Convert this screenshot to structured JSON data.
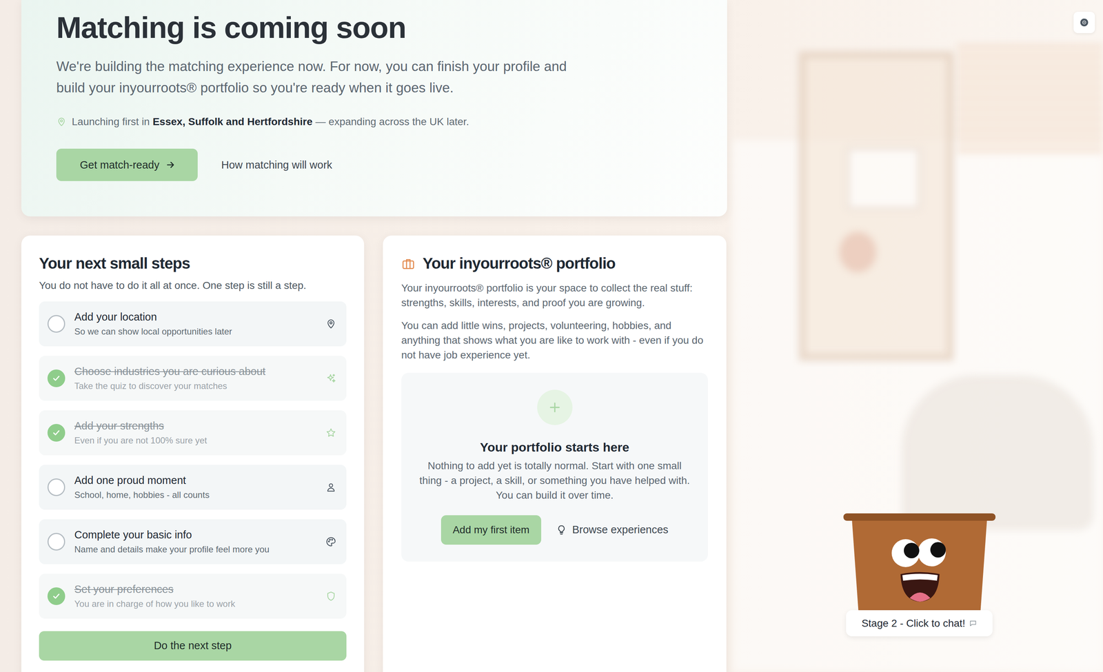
{
  "hero": {
    "title": "Matching is coming soon",
    "subtitle": "We're building the matching experience now. For now, you can finish your profile and build your inyourroots® portfolio so you're ready when it goes live.",
    "location": {
      "prefix": "Launching first in",
      "regions": "Essex, Suffolk and Hertfordshire",
      "suffix": "— expanding across the UK later."
    },
    "primary_button": "Get match-ready",
    "secondary_link": "How matching will work"
  },
  "steps": {
    "title": "Your next small steps",
    "subtitle": "You do not have to do it all at once. One step is still a step.",
    "items": [
      {
        "title": "Add your location",
        "subtitle": "So we can show local opportunities later",
        "done": false
      },
      {
        "title": "Choose industries you are curious about",
        "subtitle": "Take the quiz to discover your matches",
        "done": true
      },
      {
        "title": "Add your strengths",
        "subtitle": "Even if you are not 100% sure yet",
        "done": true
      },
      {
        "title": "Add one proud moment",
        "subtitle": "School, home, hobbies - all counts",
        "done": false
      },
      {
        "title": "Complete your basic info",
        "subtitle": "Name and details make your profile feel more you",
        "done": false
      },
      {
        "title": "Set your preferences",
        "subtitle": "You are in charge of how you like to work",
        "done": true
      }
    ],
    "button": "Do the next step"
  },
  "portfolio": {
    "title": "Your inyourroots® portfolio",
    "paragraphs": [
      "Your inyourroots® portfolio is your space to collect the real stuff: strengths, skills, interests, and proof you are growing.",
      "You can add little wins, projects, volunteering, hobbies, and anything that shows what you are like to work with - even if you do not have job experience yet."
    ],
    "empty": {
      "title": "Your portfolio starts here",
      "text": "Nothing to add yet is totally normal. Start with one small thing - a project, a skill, or something you have helped with. You can build it over time.",
      "add_button": "Add my first item",
      "browse_button": "Browse experiences"
    }
  },
  "mascot": {
    "label": "Stage 2 - Click to chat!"
  }
}
